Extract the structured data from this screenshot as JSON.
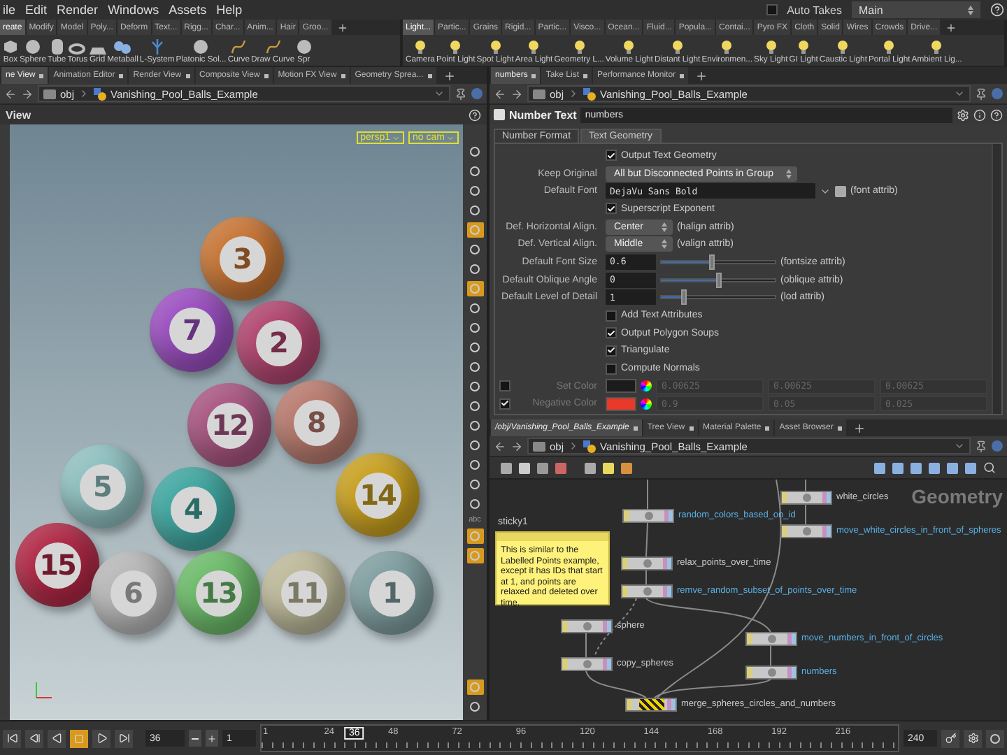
{
  "menu": [
    "ile",
    "Edit",
    "Render",
    "Windows",
    "Assets",
    "Help"
  ],
  "auto_takes": {
    "label": "Auto Takes",
    "checked": false
  },
  "take": "Main",
  "shelves": [
    {
      "tabs": [
        {
          "label": "reate",
          "selected": true
        },
        {
          "label": "Modify",
          "selected": false
        },
        {
          "label": "Model",
          "selected": false
        },
        {
          "label": "Poly...",
          "selected": false
        },
        {
          "label": "Deform",
          "selected": false
        },
        {
          "label": "Text...",
          "selected": false
        },
        {
          "label": "Rigg...",
          "selected": false
        },
        {
          "label": "Char...",
          "selected": false
        },
        {
          "label": "Anim...",
          "selected": false
        },
        {
          "label": "Hair",
          "selected": false
        },
        {
          "label": "Groo...",
          "selected": false
        }
      ],
      "tools": [
        "Box",
        "Sphere",
        "Tube",
        "Torus",
        "Grid",
        "Metaball",
        "L-System",
        "Platonic Sol...",
        "Curve",
        "Draw Curve",
        "Spr"
      ]
    },
    {
      "tabs": [
        {
          "label": "Light...",
          "selected": true
        },
        {
          "label": "Partic...",
          "selected": false
        },
        {
          "label": "Grains",
          "selected": false
        },
        {
          "label": "Rigid...",
          "selected": false
        },
        {
          "label": "Partic...",
          "selected": false
        },
        {
          "label": "Visco...",
          "selected": false
        },
        {
          "label": "Ocean...",
          "selected": false
        },
        {
          "label": "Fluid...",
          "selected": false
        },
        {
          "label": "Popula...",
          "selected": false
        },
        {
          "label": "Contai...",
          "selected": false
        },
        {
          "label": "Pyro FX",
          "selected": false
        },
        {
          "label": "Cloth",
          "selected": false
        },
        {
          "label": "Solid",
          "selected": false
        },
        {
          "label": "Wires",
          "selected": false
        },
        {
          "label": "Crowds",
          "selected": false
        },
        {
          "label": "Drive...",
          "selected": false
        }
      ],
      "tools": [
        "Camera",
        "Point Light",
        "Spot Light",
        "Area Light",
        "Geometry L...",
        "Volume Light",
        "Distant Light",
        "Environmen...",
        "Sky Light",
        "GI Light",
        "Caustic Light",
        "Portal Light",
        "Ambient Lig..."
      ]
    }
  ],
  "left_pane": {
    "tabs": [
      {
        "label": "ne View",
        "selected": true
      },
      {
        "label": "Animation Editor",
        "selected": false
      },
      {
        "label": "Render View",
        "selected": false
      },
      {
        "label": "Composite View",
        "selected": false
      },
      {
        "label": "Motion FX View",
        "selected": false
      },
      {
        "label": "Geometry Sprea...",
        "selected": false
      }
    ],
    "path": {
      "root": "obj",
      "network": "Vanishing_Pool_Balls_Example"
    },
    "viewport": {
      "title": "View",
      "camera": "persp1",
      "camera_menu": "no cam",
      "balls": [
        {
          "number": "3",
          "color": "#c77535"
        },
        {
          "number": "7",
          "color": "#9b4fc0"
        },
        {
          "number": "2",
          "color": "#b0456e"
        },
        {
          "number": "12",
          "color": "#a85580"
        },
        {
          "number": "8",
          "color": "#b87a6e"
        },
        {
          "number": "5",
          "color": "#8fc0c0"
        },
        {
          "number": "4",
          "color": "#3fa6a0"
        },
        {
          "number": "14",
          "color": "#c8a020"
        },
        {
          "number": "15",
          "color": "#b02845"
        },
        {
          "number": "6",
          "color": "#b8b8b8"
        },
        {
          "number": "13",
          "color": "#6cbb6a"
        },
        {
          "number": "11",
          "color": "#bdb99a"
        },
        {
          "number": "1",
          "color": "#7f9ea0"
        }
      ],
      "tools": [
        {
          "kind": "icon",
          "on": false
        },
        {
          "kind": "icon",
          "on": false
        },
        {
          "kind": "icon",
          "on": false
        },
        {
          "kind": "icon",
          "on": false
        },
        {
          "kind": "icon",
          "on": true
        },
        {
          "kind": "icon",
          "on": false
        },
        {
          "kind": "icon",
          "on": false
        },
        {
          "kind": "icon",
          "on": true
        },
        {
          "kind": "icon",
          "on": false
        },
        {
          "kind": "icon",
          "on": false
        },
        {
          "kind": "icon",
          "on": false
        },
        {
          "kind": "icon",
          "on": false
        },
        {
          "kind": "icon",
          "on": false
        },
        {
          "kind": "icon",
          "on": false
        },
        {
          "kind": "icon",
          "on": false
        },
        {
          "kind": "icon",
          "on": false
        },
        {
          "kind": "icon",
          "on": false
        },
        {
          "kind": "icon",
          "on": false
        },
        {
          "kind": "icon",
          "on": false
        },
        {
          "kind": "text",
          "label": "abc"
        },
        {
          "kind": "icon",
          "on": true
        },
        {
          "kind": "icon",
          "on": true
        },
        {
          "kind": "icon",
          "on": true
        },
        {
          "kind": "icon",
          "on": false
        }
      ]
    }
  },
  "right_pane": {
    "tabs": [
      {
        "label": "numbers",
        "selected": true
      },
      {
        "label": "Take List",
        "selected": false
      },
      {
        "label": "Performance Monitor",
        "selected": false
      }
    ],
    "path": {
      "root": "obj",
      "network": "Vanishing_Pool_Balls_Example"
    },
    "parameters": {
      "node_type": "Number Text",
      "node_name": "numbers",
      "tabs": [
        {
          "label": "Number Format",
          "selected": false
        },
        {
          "label": "Text Geometry",
          "selected": true
        }
      ],
      "rows": [
        {
          "kind": "checkbox",
          "label": "Output Text Geometry",
          "checked": true
        },
        {
          "kind": "menu",
          "label": "Keep Original",
          "value": "All but Disconnected Points in Group"
        },
        {
          "kind": "font",
          "label": "Default Font",
          "value": "DejaVu Sans Bold",
          "note": "(font attrib)"
        },
        {
          "kind": "checkbox",
          "label": "Superscript Exponent",
          "checked": true
        },
        {
          "kind": "menu",
          "label": "Def. Horizontal Align.",
          "value": "Center",
          "note": "(halign attrib)"
        },
        {
          "kind": "menu",
          "label": "Def. Vertical Align.",
          "value": "Middle",
          "note": "(valign attrib)"
        },
        {
          "kind": "slider",
          "label": "Default Font Size",
          "value": "0.6",
          "level": 0.45,
          "note": "(fontsize attrib)"
        },
        {
          "kind": "slider",
          "label": "Default Oblique Angle",
          "value": "0",
          "level": 0.5,
          "note": "(oblique attrib)"
        },
        {
          "kind": "slider",
          "label": "Default Level of Detail",
          "value": "1",
          "level": 0.2,
          "note": "(lod attrib)"
        },
        {
          "kind": "checkbox",
          "label": "Add Text Attributes",
          "checked": false
        },
        {
          "kind": "checkbox",
          "label": "Output Polygon Soups",
          "checked": true
        },
        {
          "kind": "checkbox",
          "label": "Triangulate",
          "checked": true
        },
        {
          "kind": "checkbox",
          "label": "Compute Normals",
          "checked": false
        },
        {
          "kind": "color",
          "label": "Set Color",
          "enabled": false,
          "color": "#1c1c1c",
          "values": [
            "0.00625",
            "0.00625",
            "0.00625"
          ]
        },
        {
          "kind": "color",
          "label": "Negative Color",
          "enabled": true,
          "color": "#e8392a",
          "values": [
            "0.9",
            "0.05",
            "0.025"
          ]
        }
      ]
    }
  },
  "network_pane": {
    "tabs": [
      {
        "label": "/obj/Vanishing_Pool_Balls_Example",
        "selected": true
      },
      {
        "label": "Tree View",
        "selected": false
      },
      {
        "label": "Material Palette",
        "selected": false
      },
      {
        "label": "Asset Browser",
        "selected": false
      }
    ],
    "path": {
      "root": "obj",
      "network": "Vanishing_Pool_Balls_Example"
    },
    "context": "Geometry",
    "sticky": {
      "name": "sticky1",
      "text": "This is similar to the Labelled Points example, except it has IDs that start at 1, and points are relaxed and deleted over time."
    },
    "nodes": [
      {
        "name": "random_colors_based_on_id",
        "highlighted": true,
        "display": false
      },
      {
        "name": "relax_points_over_time",
        "highlighted": false,
        "display": false
      },
      {
        "name": "remve_random_subset_of_points_over_time",
        "highlighted": true,
        "display": false
      },
      {
        "name": "sphere",
        "highlighted": false,
        "display": false
      },
      {
        "name": "copy_spheres",
        "highlighted": false,
        "display": false
      },
      {
        "name": "white_circles",
        "highlighted": false,
        "display": false
      },
      {
        "name": "move_white_circles_in_front_of_spheres",
        "highlighted": true,
        "display": false
      },
      {
        "name": "move_numbers_in_front_of_circles",
        "highlighted": true,
        "display": false
      },
      {
        "name": "numbers",
        "highlighted": true,
        "display": false
      },
      {
        "name": "merge_spheres_circles_and_numbers",
        "highlighted": false,
        "display": true
      }
    ]
  },
  "timeline": {
    "frame": "36",
    "step": "1",
    "end": "240",
    "current": "36",
    "level": 0.146,
    "ticks": [
      "1",
      "24",
      "48",
      "72",
      "96",
      "120",
      "144",
      "168",
      "192",
      "216"
    ]
  }
}
